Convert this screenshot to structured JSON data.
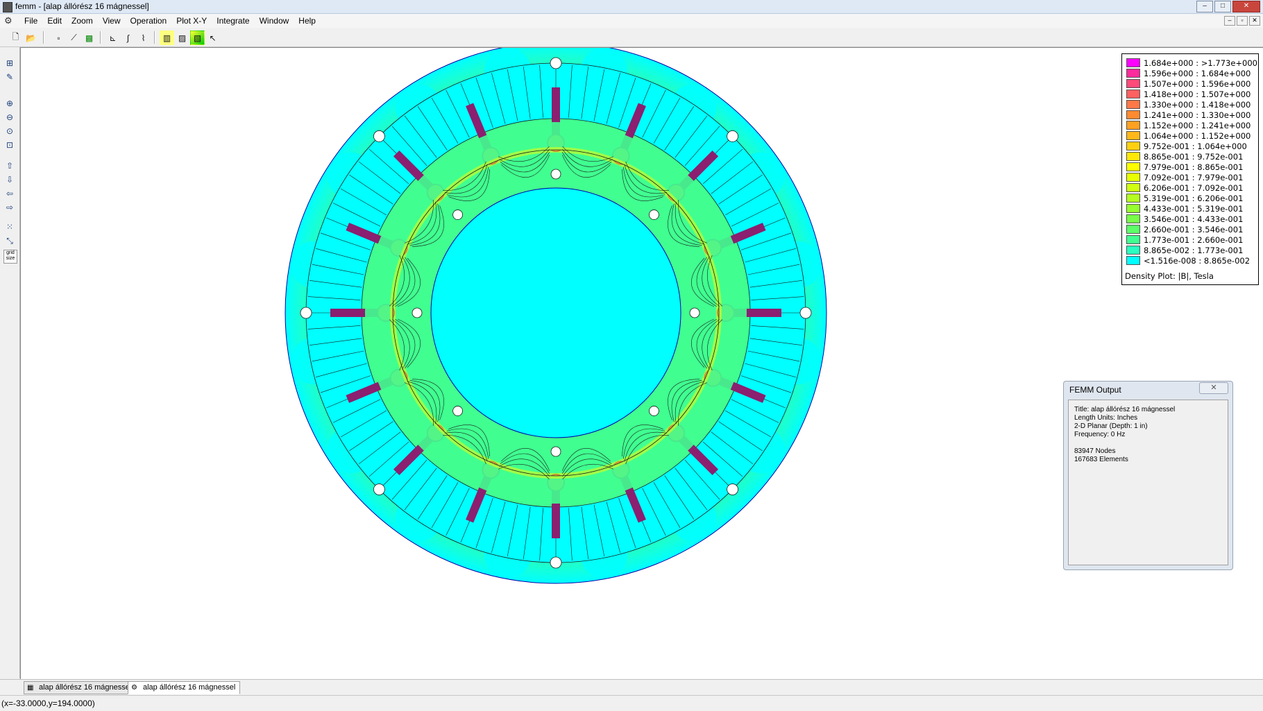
{
  "window": {
    "title": "femm - [alap állórész 16 mágnessel]",
    "controls": [
      "–",
      "□",
      "✕"
    ]
  },
  "menubar": {
    "items": [
      "File",
      "Edit",
      "Zoom",
      "View",
      "Operation",
      "Plot X-Y",
      "Integrate",
      "Window",
      "Help"
    ],
    "mdi_controls": [
      "–",
      "▫",
      "✕"
    ]
  },
  "toolbar": {
    "buttons": [
      {
        "name": "new-document-icon",
        "glyph": "🗋"
      },
      {
        "name": "open-folder-icon",
        "glyph": "📂"
      },
      {
        "name": "point-mode-icon",
        "glyph": "▫"
      },
      {
        "name": "contour-mode-icon",
        "glyph": "⟋"
      },
      {
        "name": "area-mode-icon",
        "glyph": "▩"
      },
      {
        "name": "plot-xy-icon",
        "glyph": "⊾"
      },
      {
        "name": "integrate-icon",
        "glyph": "∫"
      },
      {
        "name": "circuit-icon",
        "glyph": "⌇"
      },
      {
        "name": "contour-plot-icon",
        "glyph": "▥"
      },
      {
        "name": "density-plot-icon",
        "glyph": "▨"
      },
      {
        "name": "vector-plot-icon",
        "glyph": "▧"
      },
      {
        "name": "pointer-icon",
        "glyph": "↖"
      }
    ]
  },
  "left_toolbar": {
    "buttons": [
      {
        "name": "mesh-icon",
        "glyph": "⊞"
      },
      {
        "name": "edit-icon",
        "glyph": "✎"
      },
      {
        "name": "zoom-in-icon",
        "glyph": "⊕"
      },
      {
        "name": "zoom-out-icon",
        "glyph": "⊖"
      },
      {
        "name": "zoom-natural-icon",
        "glyph": "⊙"
      },
      {
        "name": "zoom-window-icon",
        "glyph": "⊡"
      },
      {
        "name": "pan-up-icon",
        "glyph": "⇧"
      },
      {
        "name": "pan-down-icon",
        "glyph": "⇩"
      },
      {
        "name": "pan-left-icon",
        "glyph": "⇦"
      },
      {
        "name": "pan-right-icon",
        "glyph": "⇨"
      },
      {
        "name": "grid-toggle-icon",
        "glyph": "⁙"
      },
      {
        "name": "snap-grid-icon",
        "glyph": "⤡"
      },
      {
        "name": "grid-size-icon",
        "glyph": "grid size"
      }
    ]
  },
  "legend": {
    "title": "Density Plot: |B|, Tesla",
    "rows": [
      {
        "label": "1.684e+000 : >1.773e+000",
        "color": "#ff00ff"
      },
      {
        "label": "1.596e+000 : 1.684e+000",
        "color": "#ff2a9c"
      },
      {
        "label": "1.507e+000 : 1.596e+000",
        "color": "#ff4a7a"
      },
      {
        "label": "1.418e+000 : 1.507e+000",
        "color": "#ff6060"
      },
      {
        "label": "1.330e+000 : 1.418e+000",
        "color": "#ff7848"
      },
      {
        "label": "1.241e+000 : 1.330e+000",
        "color": "#ff8a30"
      },
      {
        "label": "1.152e+000 : 1.241e+000",
        "color": "#ffa020"
      },
      {
        "label": "1.064e+000 : 1.152e+000",
        "color": "#ffb818"
      },
      {
        "label": "9.752e-001 : 1.064e+000",
        "color": "#ffd010"
      },
      {
        "label": "8.865e-001 : 9.752e-001",
        "color": "#ffe808"
      },
      {
        "label": "7.979e-001 : 8.865e-001",
        "color": "#ffff00"
      },
      {
        "label": "7.092e-001 : 7.979e-001",
        "color": "#e8ff00"
      },
      {
        "label": "6.206e-001 : 7.092e-001",
        "color": "#d0ff10"
      },
      {
        "label": "5.319e-001 : 6.206e-001",
        "color": "#b4ff20"
      },
      {
        "label": "4.433e-001 : 5.319e-001",
        "color": "#96ff30"
      },
      {
        "label": "3.546e-001 : 4.433e-001",
        "color": "#78ff48"
      },
      {
        "label": "2.660e-001 : 3.546e-001",
        "color": "#5cff68"
      },
      {
        "label": "1.773e-001 : 2.660e-001",
        "color": "#40ff90"
      },
      {
        "label": "8.865e-002 : 1.773e-001",
        "color": "#28ffc0"
      },
      {
        "label": "<1.516e-008 : 8.865e-002",
        "color": "#00ffff"
      }
    ]
  },
  "output_window": {
    "title": "FEMM Output",
    "close": "✕",
    "lines": [
      "Title: alap állórész 16 mágnessel",
      "Length Units: Inches",
      "2-D Planar (Depth: 1 in)",
      "Frequency: 0 Hz",
      "",
      "83947 Nodes",
      "167683 Elements"
    ]
  },
  "tabs": [
    {
      "label": "alap állórész 16 mágnessel",
      "icon": "▦",
      "active": false
    },
    {
      "label": "alap állórész 16 mágnessel",
      "icon": "⚙",
      "active": true
    }
  ],
  "status": {
    "coords": "(x=-33.0000,y=194.0000)"
  },
  "plot": {
    "colors": {
      "low": "#00ffff",
      "mid": "#40ff90",
      "high": "#ffff00",
      "magnet": "#8b1f70",
      "line": "#1a1a1a",
      "outline": "#0000aa"
    },
    "magnet_count": 16,
    "slot_count": 48
  }
}
